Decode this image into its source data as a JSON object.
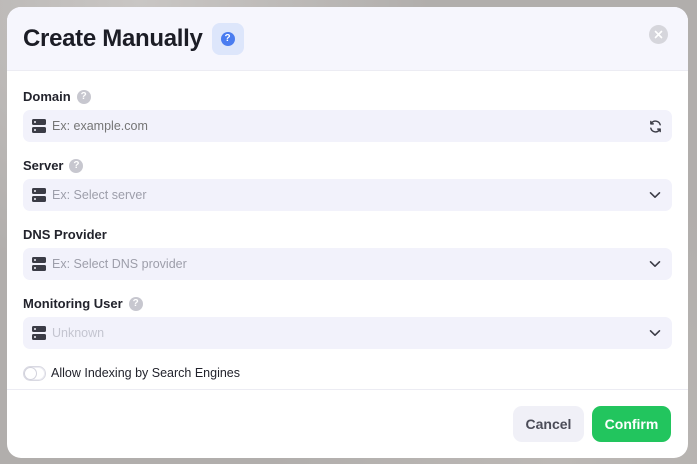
{
  "modal": {
    "title": "Create Manually",
    "help_icon": "question-circle-icon",
    "close_icon": "close-icon"
  },
  "fields": {
    "domain": {
      "label": "Domain",
      "placeholder": "Ex: example.com",
      "value": "",
      "leading_icon": "server-icon",
      "trailing_icon": "refresh-icon",
      "has_help": true
    },
    "server": {
      "label": "Server",
      "placeholder": "Ex: Select server",
      "leading_icon": "server-icon",
      "trailing_icon": "chevron-down-icon",
      "has_help": true
    },
    "dns_provider": {
      "label": "DNS Provider",
      "placeholder": "Ex: Select DNS provider",
      "leading_icon": "server-icon",
      "trailing_icon": "chevron-down-icon",
      "has_help": false
    },
    "monitoring_user": {
      "label": "Monitoring User",
      "placeholder": "Unknown",
      "leading_icon": "server-icon",
      "trailing_icon": "chevron-down-icon",
      "has_help": true
    }
  },
  "indexing_toggle": {
    "label": "Allow Indexing by Search Engines",
    "checked": false
  },
  "footer": {
    "cancel_label": "Cancel",
    "confirm_label": "Confirm"
  },
  "colors": {
    "accent": "#22c55e",
    "help_blue": "#4a7cf0",
    "input_bg": "#f2f2fb",
    "header_bg": "#f6f6fd"
  },
  "help_glyph": "?"
}
